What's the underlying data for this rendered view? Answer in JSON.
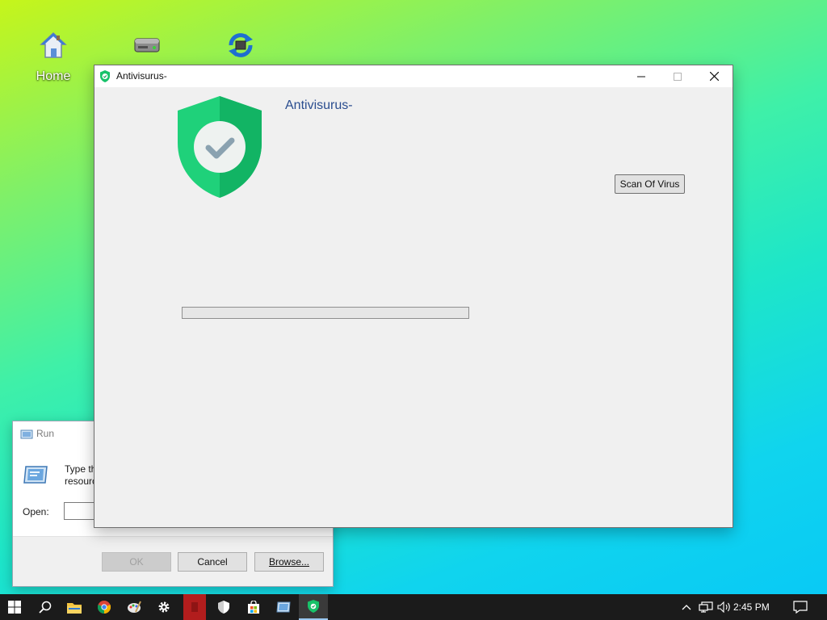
{
  "desktop": {
    "icons": [
      {
        "name": "home",
        "label": "Home"
      },
      {
        "name": "drive",
        "label": ""
      },
      {
        "name": "sync",
        "label": ""
      }
    ]
  },
  "run_dialog": {
    "title": "Run",
    "description_line1": "Type th",
    "description_line2": "resourc",
    "open_label": "Open:",
    "open_value": "",
    "ok_label": "OK",
    "cancel_label": "Cancel",
    "browse_label": "Browse..."
  },
  "antivirus_window": {
    "title": "Antivisurus-",
    "heading": "Antivisurus-",
    "scan_button_label": "Scan Of Virus",
    "progress_percent": 0,
    "accent_color": "#18c26a"
  },
  "taskbar": {
    "items": [
      "start",
      "search",
      "file-explorer",
      "chrome",
      "paint",
      "settings",
      "red-app",
      "security",
      "store",
      "run",
      "antivirus"
    ],
    "clock": "2:45 PM"
  }
}
